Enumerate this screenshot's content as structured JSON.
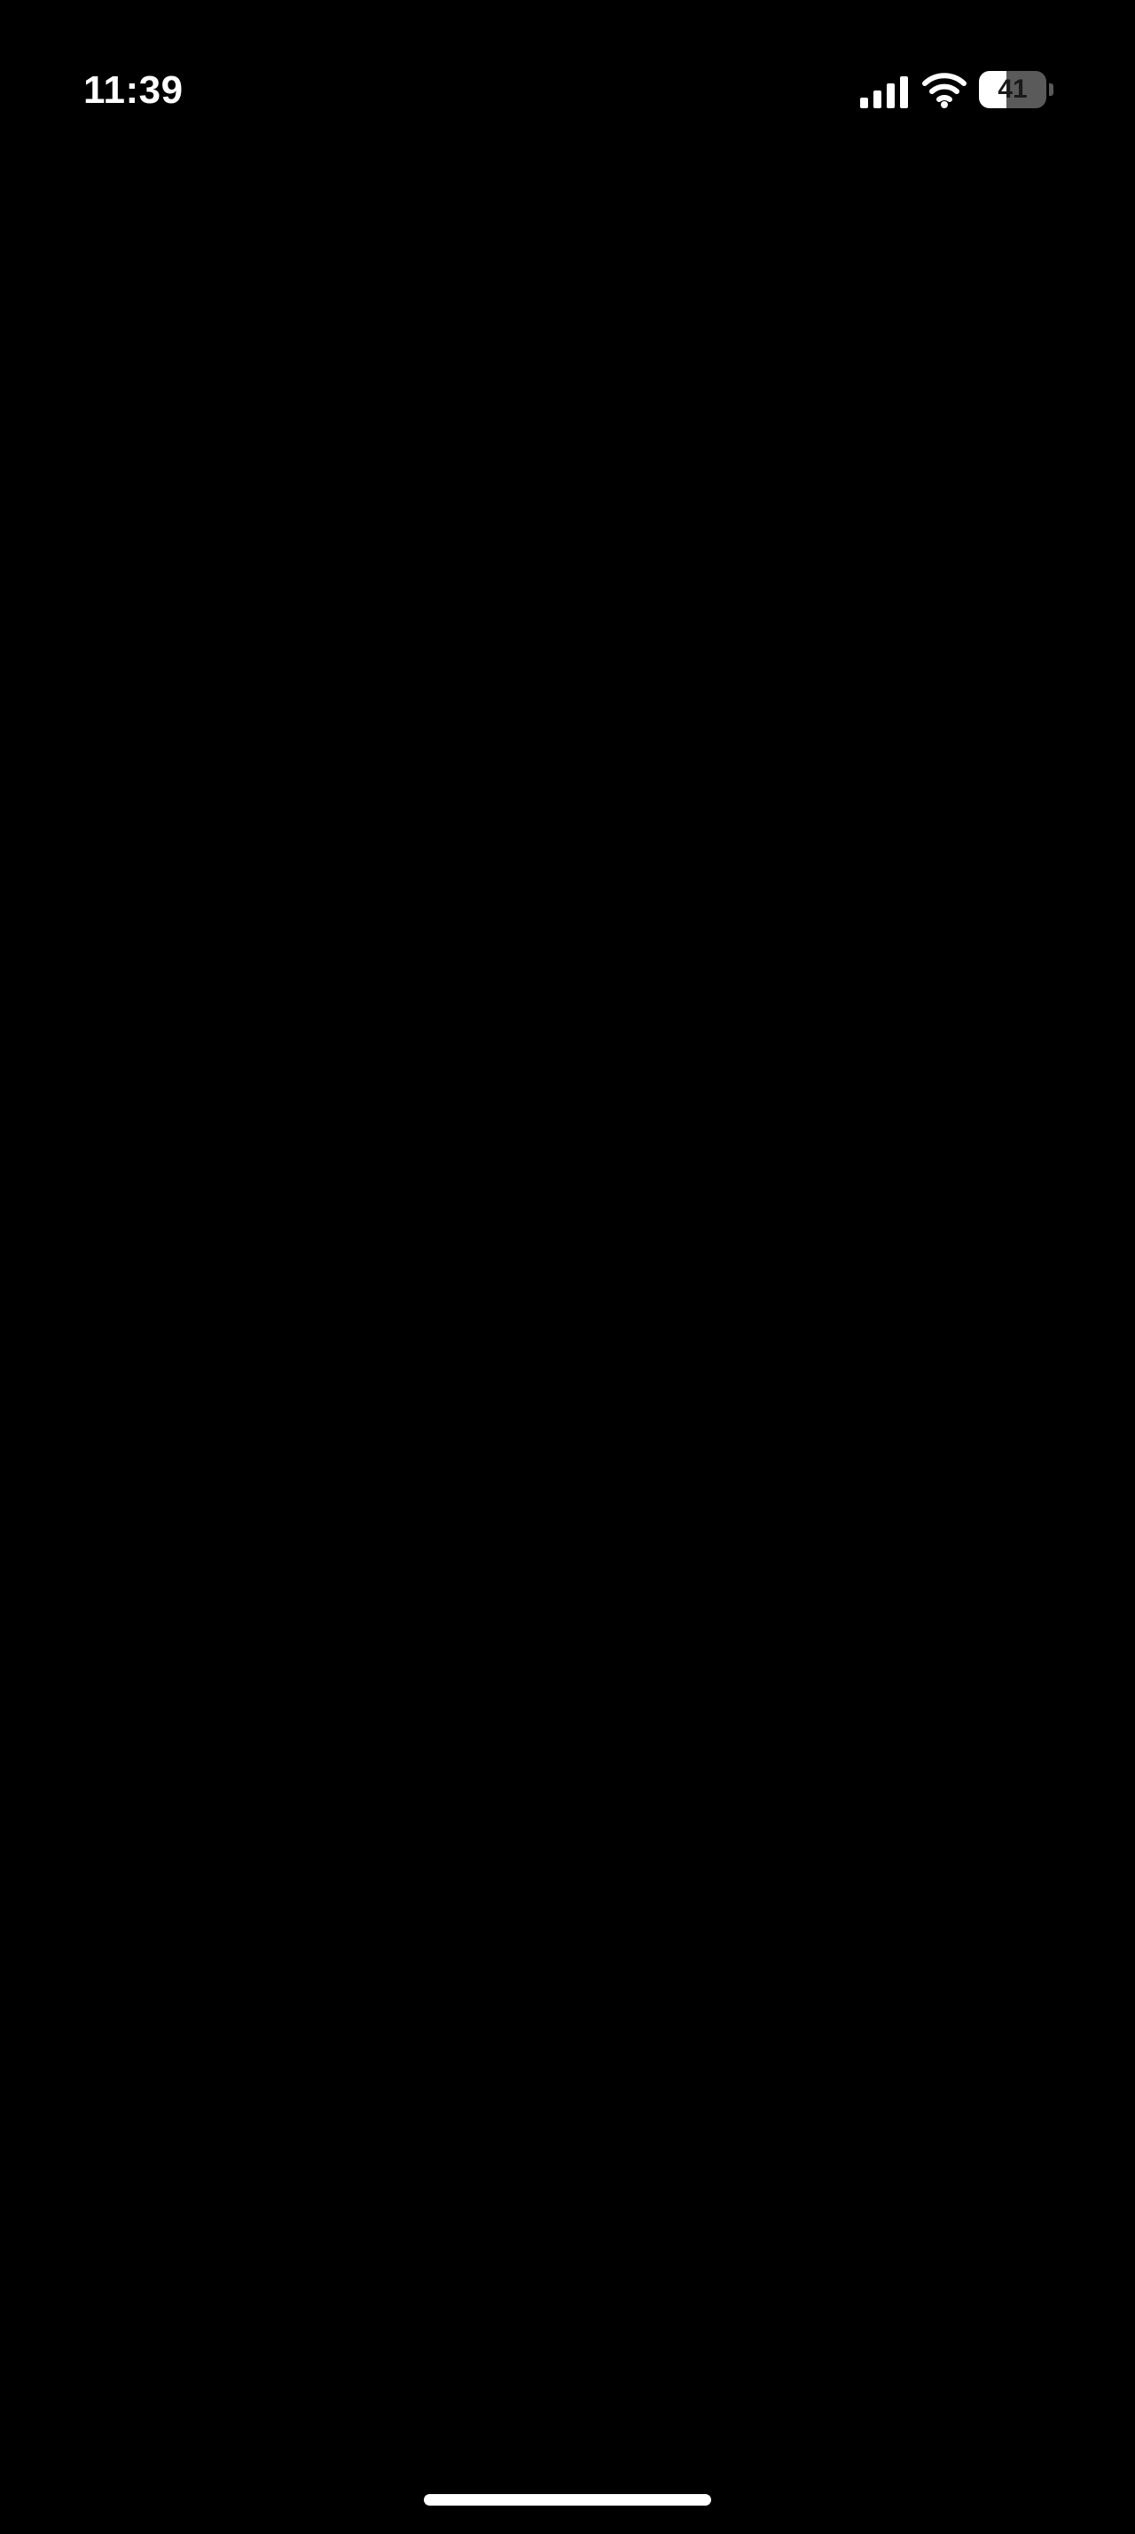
{
  "status_bar": {
    "time": "11:39",
    "battery_level": "41",
    "battery_fraction": 0.41,
    "cell_signal_icon": "cellular-signal-icon",
    "wifi_icon": "wifi-icon",
    "battery_icon": "battery-icon"
  },
  "colors": {
    "background": "#000000",
    "foreground": "#ffffff"
  }
}
